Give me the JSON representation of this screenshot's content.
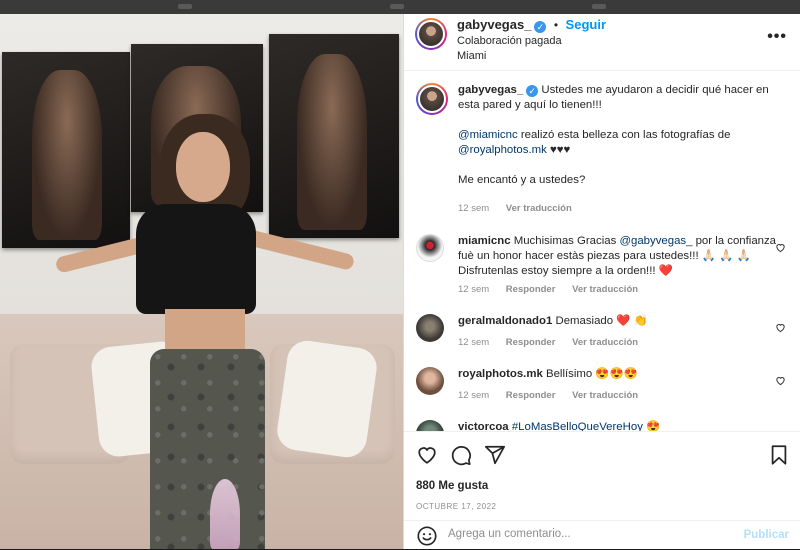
{
  "post": {
    "username": "gabyvegas_",
    "follow_label": "Seguir",
    "collab_label": "Colaboración pagada",
    "location": "Miami",
    "more_label": "•••"
  },
  "caption": {
    "username": "gabyvegas_",
    "line1": "Ustedes me ayudaron a decidir qué hacer en esta pared y aquí lo tienen!!!",
    "mention1": "@miamicnc",
    "line2": " realizó esta belleza con las fotografías de ",
    "mention2": "@royalphotos.mk",
    "hearts": " ♥♥♥",
    "line3": "Me encantó y a ustedes?",
    "time": "12 sem",
    "see_translation": "Ver traducción"
  },
  "comments": [
    {
      "username": "miamicnc",
      "text_a": " Muchisimas Gracias ",
      "mention": "@gabyvegas_",
      "text_b": " por la confianza fuè un honor hacer estàs piezas para ustedes!!! 🙏🏻 🙏🏻 🙏🏻 Disfrutenlas estoy siempre a la orden!!! ❤️",
      "time": "12 sem",
      "reply": "Responder",
      "see_translation": "Ver traducción"
    },
    {
      "username": "geralmaldonado1",
      "text_a": " Demasiado ❤️ 👏",
      "time": "12 sem",
      "reply": "Responder",
      "see_translation": "Ver traducción"
    },
    {
      "username": "royalphotos.mk",
      "text_a": " Bellísimo 😍😍😍",
      "time": "12 sem",
      "reply": "Responder",
      "see_translation": "Ver traducción"
    },
    {
      "username": "victorcoa",
      "mention": "#LoMasBelloQueVereHoy",
      "text_b": " 😍"
    }
  ],
  "footer": {
    "likes": "880 Me gusta",
    "date": "OCTUBRE 17, 2022",
    "comment_placeholder": "Agrega un comentario...",
    "publish_label": "Publicar"
  },
  "icons": {
    "like": "heart-icon",
    "comment": "comment-icon",
    "share": "share-icon",
    "save": "bookmark-icon",
    "emoji": "emoji-icon"
  }
}
